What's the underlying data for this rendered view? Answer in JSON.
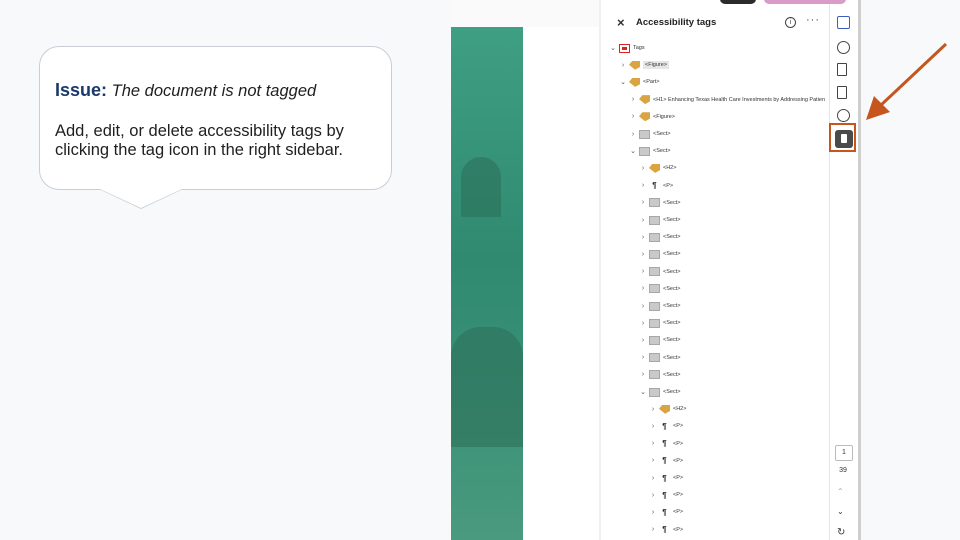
{
  "callout": {
    "issue_label": "Issue:",
    "issue_text": "The document is not tagged",
    "body": "Add, edit, or delete accessibility tags by clicking the tag icon in the right sidebar."
  },
  "panel": {
    "close_label": "×",
    "title": "Accessibility tags",
    "info_label": "i",
    "more_label": "···"
  },
  "tags": [
    {
      "chev": "⌄",
      "icon": "pdf",
      "label": "Tags"
    },
    {
      "chev": "›",
      "icon": "tag",
      "label": "<Figure>",
      "selected": true
    },
    {
      "chev": "⌄",
      "icon": "tag",
      "label": "<Part>"
    },
    {
      "chev": "›",
      "icon": "tag",
      "label": "<H1> Enhancing Texas Health Care Investments by Addressing Patien"
    },
    {
      "chev": "›",
      "icon": "tag",
      "label": "<Figure>"
    },
    {
      "chev": "›",
      "icon": "sect",
      "label": "<Sect>"
    },
    {
      "chev": "⌄",
      "icon": "sect",
      "label": "<Sect>"
    },
    {
      "chev": "›",
      "icon": "tag",
      "label": "<H2>"
    },
    {
      "chev": "›",
      "icon": "para",
      "label": "<P>"
    },
    {
      "chev": "›",
      "icon": "sect",
      "label": "<Sect>"
    },
    {
      "chev": "›",
      "icon": "sect",
      "label": "<Sect>"
    },
    {
      "chev": "›",
      "icon": "sect",
      "label": "<Sect>"
    },
    {
      "chev": "›",
      "icon": "sect",
      "label": "<Sect>"
    },
    {
      "chev": "›",
      "icon": "sect",
      "label": "<Sect>"
    },
    {
      "chev": "›",
      "icon": "sect",
      "label": "<Sect>"
    },
    {
      "chev": "›",
      "icon": "sect",
      "label": "<Sect>"
    },
    {
      "chev": "›",
      "icon": "sect",
      "label": "<Sect>"
    },
    {
      "chev": "›",
      "icon": "sect",
      "label": "<Sect>"
    },
    {
      "chev": "›",
      "icon": "sect",
      "label": "<Sect>"
    },
    {
      "chev": "›",
      "icon": "sect",
      "label": "<Sect>"
    },
    {
      "chev": "⌄",
      "icon": "sect",
      "label": "<Sect>"
    },
    {
      "chev": "›",
      "icon": "tag",
      "label": "<H2>"
    },
    {
      "chev": "›",
      "icon": "para",
      "label": "<P>"
    },
    {
      "chev": "›",
      "icon": "para",
      "label": "<P>"
    },
    {
      "chev": "›",
      "icon": "para",
      "label": "<P>"
    },
    {
      "chev": "›",
      "icon": "para",
      "label": "<P>"
    },
    {
      "chev": "›",
      "icon": "para",
      "label": "<P>"
    },
    {
      "chev": "›",
      "icon": "para",
      "label": "<P>"
    },
    {
      "chev": "›",
      "icon": "para",
      "label": "<P>"
    }
  ],
  "rail": {
    "page_number": "1",
    "page_total": "39",
    "nav_up": "⌃",
    "nav_down": "⌄",
    "refresh": "↻"
  },
  "colors": {
    "issue_label": "#1b3a6b",
    "arrow": "#c4561e",
    "page_green": "#3f9f83"
  }
}
